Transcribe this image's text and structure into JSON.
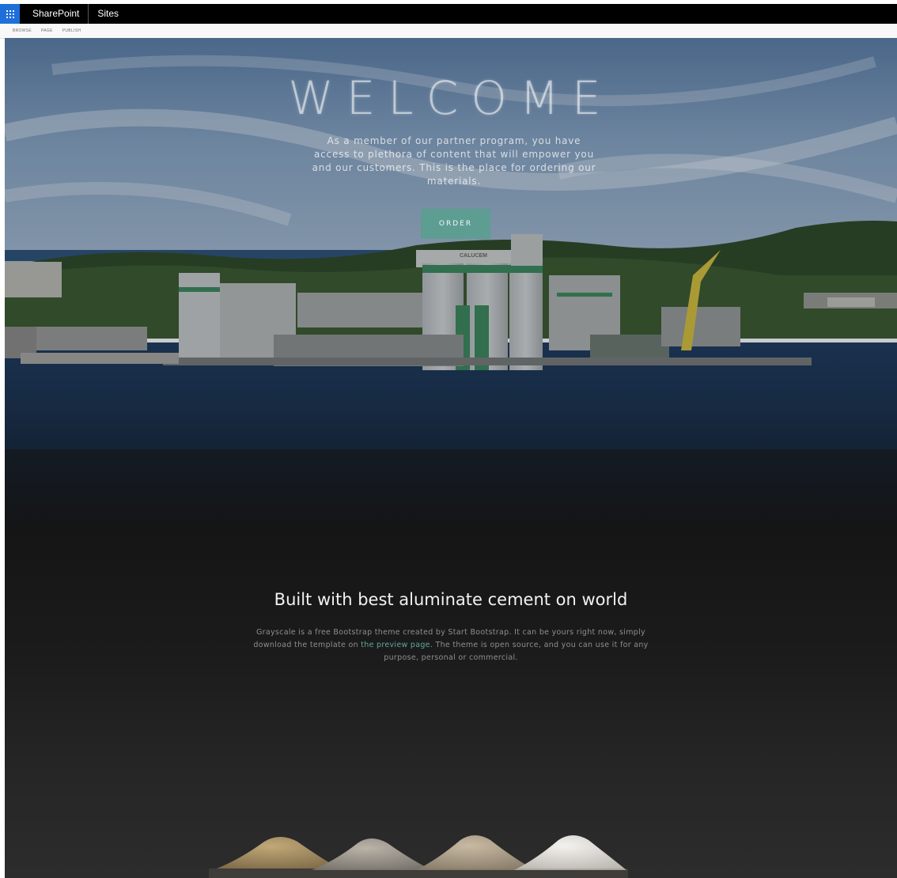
{
  "suitebar": {
    "brand": "SharePoint",
    "sites": "Sites"
  },
  "ribbon": {
    "tabs": [
      "BROWSE",
      "PAGE",
      "PUBLISH"
    ]
  },
  "hero": {
    "title": "WELCOME",
    "intro": "As a member of our partner program, you have access to plethora of content that will empower you and our customers. This is the place for ordering our materials.",
    "order_label": "ORDER",
    "plant_sign": "CALUCEM"
  },
  "about": {
    "title": "Built with best aluminate cement on world",
    "text_before": "Grayscale is a free Bootstrap theme created by Start Bootstrap. It can be yours right now, simply download the template on ",
    "link_text": "the preview page",
    "text_after": ". The theme is open source, and you can use it for any purpose, personal or commercial."
  },
  "colors": {
    "waffle_blue": "#1e6fd9",
    "accent_teal": "#5e9d92",
    "link_teal": "#5fa89a"
  },
  "icons": {
    "app_launcher": "waffle-icon"
  }
}
